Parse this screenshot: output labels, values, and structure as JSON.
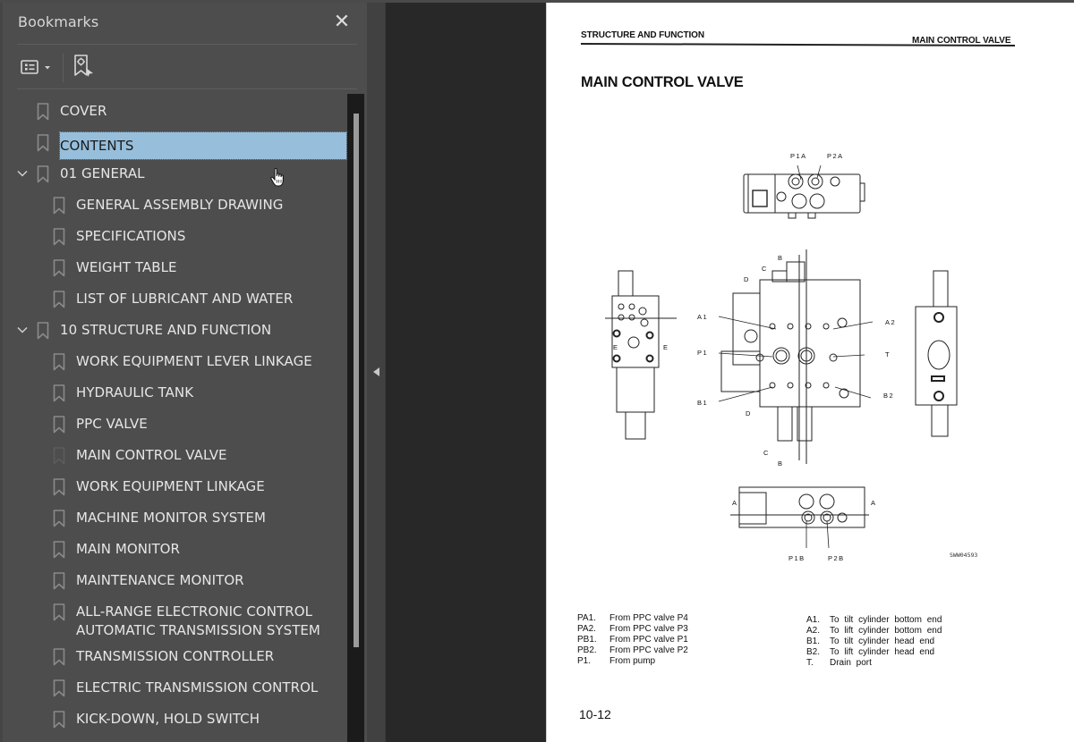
{
  "bookmarks_panel": {
    "title": "Bookmarks",
    "close_icon": "close-icon",
    "toolbar": {
      "options_icon": "list-options-icon",
      "find_icon": "find-current-bookmark-icon"
    },
    "items": [
      {
        "label": "COVER",
        "level": 0,
        "expandable": false,
        "selected": false
      },
      {
        "label": "CONTENTS",
        "level": 0,
        "expandable": false,
        "selected": true
      },
      {
        "label": "01 GENERAL",
        "level": 0,
        "expandable": true,
        "expanded": true,
        "selected": false
      },
      {
        "label": "GENERAL ASSEMBLY DRAWING",
        "level": 1,
        "selected": false
      },
      {
        "label": "SPECIFICATIONS",
        "level": 1,
        "selected": false
      },
      {
        "label": "WEIGHT TABLE",
        "level": 1,
        "selected": false
      },
      {
        "label": "LIST OF LUBRICANT AND WATER",
        "level": 1,
        "selected": false
      },
      {
        "label": "10 STRUCTURE AND FUNCTION",
        "level": 0,
        "expandable": true,
        "expanded": true,
        "selected": false
      },
      {
        "label": "WORK EQUIPMENT LEVER LINKAGE",
        "level": 1,
        "selected": false
      },
      {
        "label": "HYDRAULIC TANK",
        "level": 1,
        "selected": false
      },
      {
        "label": "PPC VALVE",
        "level": 1,
        "selected": false
      },
      {
        "label": "MAIN CONTROL VALVE",
        "level": 1,
        "selected": false,
        "current_page": true
      },
      {
        "label": "WORK EQUIPMENT LINKAGE",
        "level": 1,
        "selected": false
      },
      {
        "label": "MACHINE MONITOR SYSTEM",
        "level": 1,
        "selected": false
      },
      {
        "label": "MAIN MONITOR",
        "level": 1,
        "selected": false
      },
      {
        "label": "MAINTENANCE MONITOR",
        "level": 1,
        "selected": false
      },
      {
        "label": "ALL-RANGE ELECTRONIC CONTROL",
        "label_line2": "AUTOMATIC TRANSMISSION SYSTEM",
        "level": 1,
        "selected": false
      },
      {
        "label": "TRANSMISSION CONTROLLER",
        "level": 1,
        "selected": false
      },
      {
        "label": "ELECTRIC TRANSMISSION CONTROL",
        "level": 1,
        "selected": false
      },
      {
        "label": "KICK-DOWN, HOLD SWITCH",
        "level": 1,
        "selected": false
      }
    ],
    "scroll_position_fraction": 0.03,
    "scroll_visible_fraction": 0.82
  },
  "splitter": {
    "collapse_icon": "collapse-left-arrow-icon"
  },
  "document": {
    "header_left": "STRUCTURE AND FUNCTION",
    "header_right": "MAIN CONTROL VALVE",
    "title": "MAIN CONTROL VALVE",
    "figure_labels": {
      "top_view": [
        "P1A",
        "P2A"
      ],
      "front_view": [
        "A1",
        "A2",
        "P1",
        "T",
        "B1",
        "B2"
      ],
      "section_marks": [
        "B",
        "C",
        "D",
        "E",
        "A"
      ],
      "bottom_view": [
        "P1B",
        "P2B"
      ],
      "figure_id": "SWW04593"
    },
    "legend_left": [
      {
        "code": "PA1.",
        "desc": "From PPC valve P4"
      },
      {
        "code": "PA2.",
        "desc": "From PPC valve P3"
      },
      {
        "code": "PB1.",
        "desc": "From PPC valve P1"
      },
      {
        "code": "PB2.",
        "desc": "From PPC valve P2"
      },
      {
        "code": "P1.",
        "desc": "From pump"
      }
    ],
    "legend_right": [
      {
        "code": "A1.",
        "desc": "To tilt cylinder bottom end"
      },
      {
        "code": "A2.",
        "desc": "To lift cylinder bottom end"
      },
      {
        "code": "B1.",
        "desc": "To tilt cylinder head end"
      },
      {
        "code": "B2.",
        "desc": "To lift cylinder head end"
      },
      {
        "code": "T.",
        "desc": "Drain port"
      }
    ],
    "page_number": "10-12"
  },
  "colors": {
    "panel_bg": "#4d4d4d",
    "selection_bg": "#97bfdc",
    "viewer_bg": "#282828",
    "text": "#e6e6e6"
  }
}
